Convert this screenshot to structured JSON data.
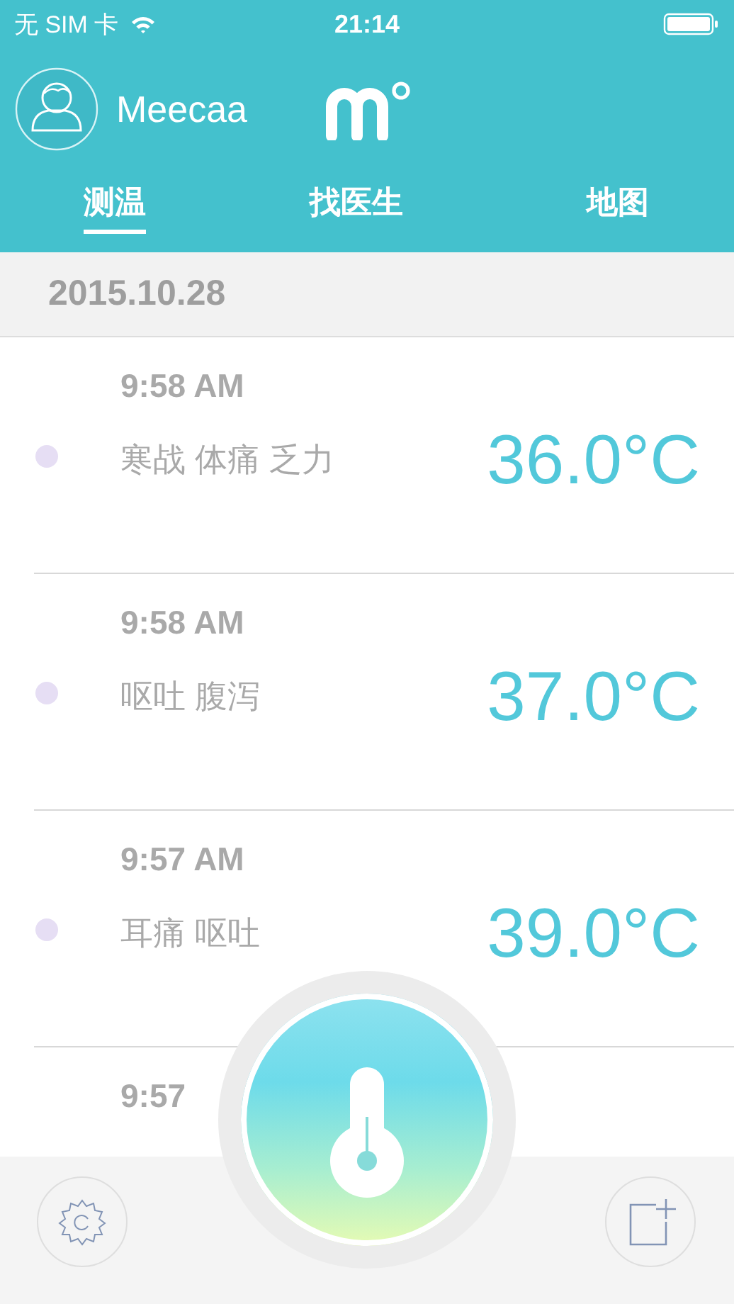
{
  "status_bar": {
    "carrier": "无 SIM 卡",
    "time": "21:14"
  },
  "header": {
    "user_name": "Meecaa"
  },
  "tabs": [
    {
      "label": "测温",
      "selected": true
    },
    {
      "label": "找医生",
      "selected": false
    },
    {
      "label": "地图",
      "selected": false
    }
  ],
  "date": "2015.10.28",
  "records": [
    {
      "time": "9:58 AM",
      "symptoms": "寒战 体痛 乏力",
      "temperature": "36.0°C"
    },
    {
      "time": "9:58 AM",
      "symptoms": "呕吐 腹泻",
      "temperature": "37.0°C"
    },
    {
      "time": "9:57 AM",
      "symptoms": "耳痛 呕吐",
      "temperature": "39.0°C"
    },
    {
      "time": "9:57"
    }
  ]
}
